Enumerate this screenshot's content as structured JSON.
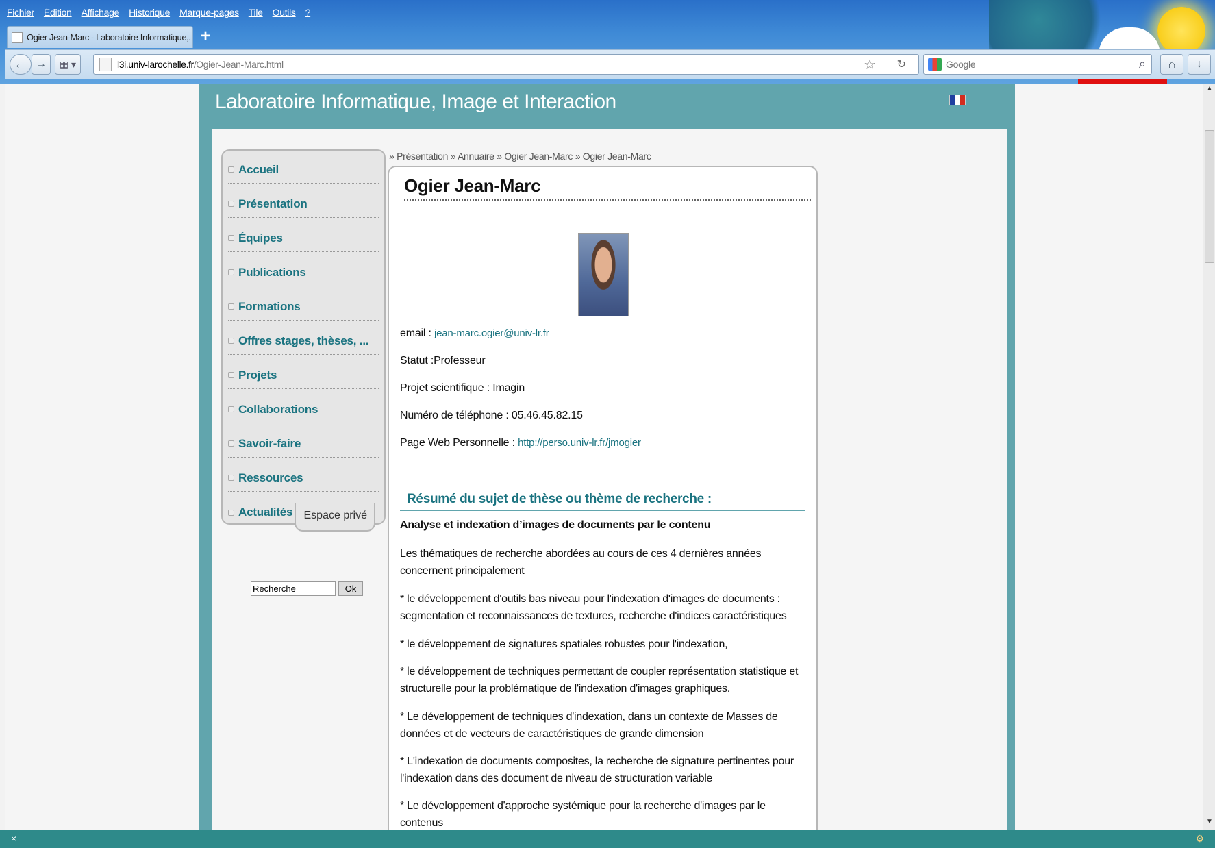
{
  "browser": {
    "menu": [
      "Fichier",
      "Édition",
      "Affichage",
      "Historique",
      "Marque-pages",
      "Tile",
      "Outils",
      "?"
    ],
    "tab_title": "Ogier Jean-Marc - Laboratoire Informatique,...",
    "new_tab": "+",
    "url_host": "l3i.univ-larochelle.fr",
    "url_path": "/Ogier-Jean-Marc.html",
    "search_placeholder": "Google"
  },
  "site": {
    "title": "Laboratoire Informatique, Image et Interaction",
    "flag_colors": [
      "#1f3fa0",
      "#ffffff",
      "#d52b1e"
    ],
    "accent": "#61a5ad",
    "link_color": "#1a7380"
  },
  "menu": {
    "items": [
      "Accueil",
      "Présentation",
      "Équipes",
      "Publications",
      "Formations",
      "Offres stages, thèses, ...",
      "Projets",
      "Collaborations",
      "Savoir-faire",
      "Ressources",
      "Actualités"
    ],
    "private": "Espace privé"
  },
  "search": {
    "value": "Recherche",
    "button": "Ok"
  },
  "breadcrumb": [
    "Présentation",
    "Annuaire",
    "Ogier Jean-Marc",
    "Ogier Jean-Marc"
  ],
  "article": {
    "title": "Ogier Jean-Marc",
    "email_label": "email :",
    "email": "jean-marc.ogier@univ-lr.fr",
    "statut": "Statut :Professeur",
    "projet": "Projet scientifique : Imagin",
    "telephone": "Numéro de téléphone : 05.46.45.82.15",
    "web_label": "Page Web Personnelle :",
    "web": "http://perso.univ-lr.fr/jmogier",
    "resume_title": "Résumé du sujet de thèse ou thème de recherche :",
    "subject": "Analyse et indexation d’images de documents par le contenu",
    "paragraphs": [
      "Les thématiques de recherche abordées au cours de ces 4 dernières années concernent principalement",
      "* le développement d'outils bas niveau pour l'indexation d'images de documents : segmentation et reconnaissances de textures, recherche d'indices caractéristiques",
      "* le développement de signatures spatiales robustes pour l'indexation,",
      "* le développement de techniques permettant de coupler représentation statistique et structurelle pour la problématique de l'indexation d'images graphiques.",
      "* Le développement de techniques d'indexation, dans un contexte de Masses de données et de vecteurs de caractéristiques de grande dimension",
      "* L'indexation de documents composites, la recherche de signature pertinentes pour l'indexation dans des document de niveau de structuration variable",
      "* Le développement d'approche systémique pour la recherche d'images par le contenus"
    ]
  }
}
